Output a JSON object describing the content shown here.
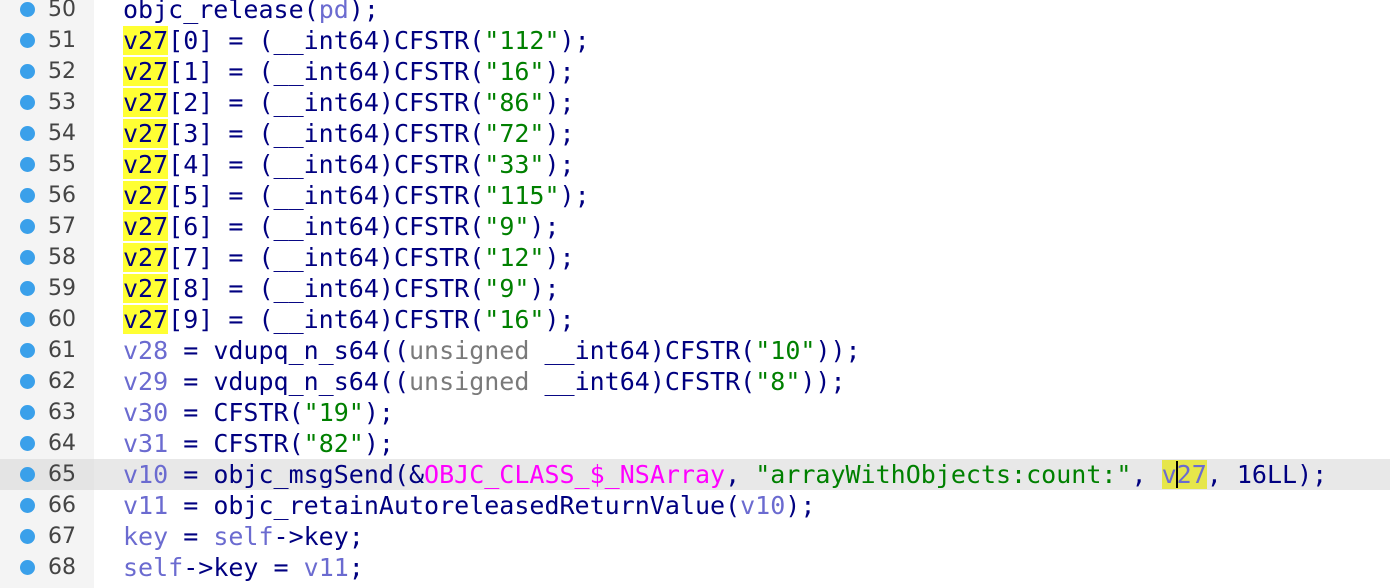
{
  "editor": {
    "lines": [
      {
        "num": "50",
        "tokens": [
          [
            "id",
            "objc_release"
          ],
          [
            "pun",
            "("
          ],
          [
            "lvar",
            "pd"
          ],
          [
            "pun",
            ");"
          ]
        ]
      },
      {
        "num": "51",
        "tokens": [
          [
            "hl",
            "v27"
          ],
          [
            "pun",
            "[0] = ("
          ],
          [
            "id",
            "__int64"
          ],
          [
            "pun",
            ")"
          ],
          [
            "id",
            "CFSTR"
          ],
          [
            "pun",
            "("
          ],
          [
            "str",
            "\"112\""
          ],
          [
            "pun",
            ");"
          ]
        ]
      },
      {
        "num": "52",
        "tokens": [
          [
            "hl",
            "v27"
          ],
          [
            "pun",
            "[1] = ("
          ],
          [
            "id",
            "__int64"
          ],
          [
            "pun",
            ")"
          ],
          [
            "id",
            "CFSTR"
          ],
          [
            "pun",
            "("
          ],
          [
            "str",
            "\"16\""
          ],
          [
            "pun",
            ");"
          ]
        ]
      },
      {
        "num": "53",
        "tokens": [
          [
            "hl",
            "v27"
          ],
          [
            "pun",
            "[2] = ("
          ],
          [
            "id",
            "__int64"
          ],
          [
            "pun",
            ")"
          ],
          [
            "id",
            "CFSTR"
          ],
          [
            "pun",
            "("
          ],
          [
            "str",
            "\"86\""
          ],
          [
            "pun",
            ");"
          ]
        ]
      },
      {
        "num": "54",
        "tokens": [
          [
            "hl",
            "v27"
          ],
          [
            "pun",
            "[3] = ("
          ],
          [
            "id",
            "__int64"
          ],
          [
            "pun",
            ")"
          ],
          [
            "id",
            "CFSTR"
          ],
          [
            "pun",
            "("
          ],
          [
            "str",
            "\"72\""
          ],
          [
            "pun",
            ");"
          ]
        ]
      },
      {
        "num": "55",
        "tokens": [
          [
            "hl",
            "v27"
          ],
          [
            "pun",
            "[4] = ("
          ],
          [
            "id",
            "__int64"
          ],
          [
            "pun",
            ")"
          ],
          [
            "id",
            "CFSTR"
          ],
          [
            "pun",
            "("
          ],
          [
            "str",
            "\"33\""
          ],
          [
            "pun",
            ");"
          ]
        ]
      },
      {
        "num": "56",
        "tokens": [
          [
            "hl",
            "v27"
          ],
          [
            "pun",
            "[5] = ("
          ],
          [
            "id",
            "__int64"
          ],
          [
            "pun",
            ")"
          ],
          [
            "id",
            "CFSTR"
          ],
          [
            "pun",
            "("
          ],
          [
            "str",
            "\"115\""
          ],
          [
            "pun",
            ");"
          ]
        ]
      },
      {
        "num": "57",
        "tokens": [
          [
            "hl",
            "v27"
          ],
          [
            "pun",
            "[6] = ("
          ],
          [
            "id",
            "__int64"
          ],
          [
            "pun",
            ")"
          ],
          [
            "id",
            "CFSTR"
          ],
          [
            "pun",
            "("
          ],
          [
            "str",
            "\"9\""
          ],
          [
            "pun",
            ");"
          ]
        ]
      },
      {
        "num": "58",
        "tokens": [
          [
            "hl",
            "v27"
          ],
          [
            "pun",
            "[7] = ("
          ],
          [
            "id",
            "__int64"
          ],
          [
            "pun",
            ")"
          ],
          [
            "id",
            "CFSTR"
          ],
          [
            "pun",
            "("
          ],
          [
            "str",
            "\"12\""
          ],
          [
            "pun",
            ");"
          ]
        ]
      },
      {
        "num": "59",
        "tokens": [
          [
            "hl",
            "v27"
          ],
          [
            "pun",
            "[8] = ("
          ],
          [
            "id",
            "__int64"
          ],
          [
            "pun",
            ")"
          ],
          [
            "id",
            "CFSTR"
          ],
          [
            "pun",
            "("
          ],
          [
            "str",
            "\"9\""
          ],
          [
            "pun",
            ");"
          ]
        ]
      },
      {
        "num": "60",
        "tokens": [
          [
            "hl",
            "v27"
          ],
          [
            "pun",
            "[9] = ("
          ],
          [
            "id",
            "__int64"
          ],
          [
            "pun",
            ")"
          ],
          [
            "id",
            "CFSTR"
          ],
          [
            "pun",
            "("
          ],
          [
            "str",
            "\"16\""
          ],
          [
            "pun",
            ");"
          ]
        ]
      },
      {
        "num": "61",
        "tokens": [
          [
            "lvar",
            "v28"
          ],
          [
            "pun",
            " = "
          ],
          [
            "id",
            "vdupq_n_s64"
          ],
          [
            "pun",
            "(("
          ],
          [
            "kw",
            "unsigned "
          ],
          [
            "id",
            "__int64"
          ],
          [
            "pun",
            ")"
          ],
          [
            "id",
            "CFSTR"
          ],
          [
            "pun",
            "("
          ],
          [
            "str",
            "\"10\""
          ],
          [
            "pun",
            "));"
          ]
        ]
      },
      {
        "num": "62",
        "tokens": [
          [
            "lvar",
            "v29"
          ],
          [
            "pun",
            " = "
          ],
          [
            "id",
            "vdupq_n_s64"
          ],
          [
            "pun",
            "(("
          ],
          [
            "kw",
            "unsigned "
          ],
          [
            "id",
            "__int64"
          ],
          [
            "pun",
            ")"
          ],
          [
            "id",
            "CFSTR"
          ],
          [
            "pun",
            "("
          ],
          [
            "str",
            "\"8\""
          ],
          [
            "pun",
            "));"
          ]
        ]
      },
      {
        "num": "63",
        "tokens": [
          [
            "lvar",
            "v30"
          ],
          [
            "pun",
            " = "
          ],
          [
            "id",
            "CFSTR"
          ],
          [
            "pun",
            "("
          ],
          [
            "str",
            "\"19\""
          ],
          [
            "pun",
            ");"
          ]
        ]
      },
      {
        "num": "64",
        "tokens": [
          [
            "lvar",
            "v31"
          ],
          [
            "pun",
            " = "
          ],
          [
            "id",
            "CFSTR"
          ],
          [
            "pun",
            "("
          ],
          [
            "str",
            "\"82\""
          ],
          [
            "pun",
            ");"
          ]
        ]
      },
      {
        "num": "65",
        "current": true,
        "tokens": [
          [
            "lvar",
            "v10"
          ],
          [
            "pun",
            " = "
          ],
          [
            "id",
            "objc_msgSend"
          ],
          [
            "pun",
            "(&"
          ],
          [
            "gbl",
            "OBJC_CLASS_$_NSArray"
          ],
          [
            "pun",
            ", "
          ],
          [
            "str",
            "\"arrayWithObjects:count:\""
          ],
          [
            "pun",
            ", "
          ],
          [
            "hl2a",
            "v"
          ],
          [
            "caret",
            ""
          ],
          [
            "hl2b",
            "27"
          ],
          [
            "pun",
            ", 16LL);"
          ]
        ]
      },
      {
        "num": "66",
        "tokens": [
          [
            "lvar",
            "v11"
          ],
          [
            "pun",
            " = "
          ],
          [
            "id",
            "objc_retainAutoreleasedReturnValue"
          ],
          [
            "pun",
            "("
          ],
          [
            "lvar",
            "v10"
          ],
          [
            "pun",
            ");"
          ]
        ]
      },
      {
        "num": "67",
        "tokens": [
          [
            "lvar",
            "key"
          ],
          [
            "pun",
            " = "
          ],
          [
            "lvar",
            "self"
          ],
          [
            "pun",
            "->key;"
          ]
        ]
      },
      {
        "num": "68",
        "tokens": [
          [
            "lvar",
            "self"
          ],
          [
            "pun",
            "->key = "
          ],
          [
            "lvar",
            "v11"
          ],
          [
            "pun",
            ";"
          ]
        ]
      }
    ]
  },
  "colors": {
    "identifier": "#000080",
    "local_variable": "#6b6bd0",
    "keyword": "#7a7a7a",
    "string": "#008000",
    "global": "#ff00ff",
    "highlight": "#ffff33",
    "highlight_current": "#e6e64a",
    "breakpoint": "#3aa0ea",
    "current_line": "#e8e8e8"
  },
  "icons": {
    "breakpoint": "breakpoint-dot-icon"
  }
}
